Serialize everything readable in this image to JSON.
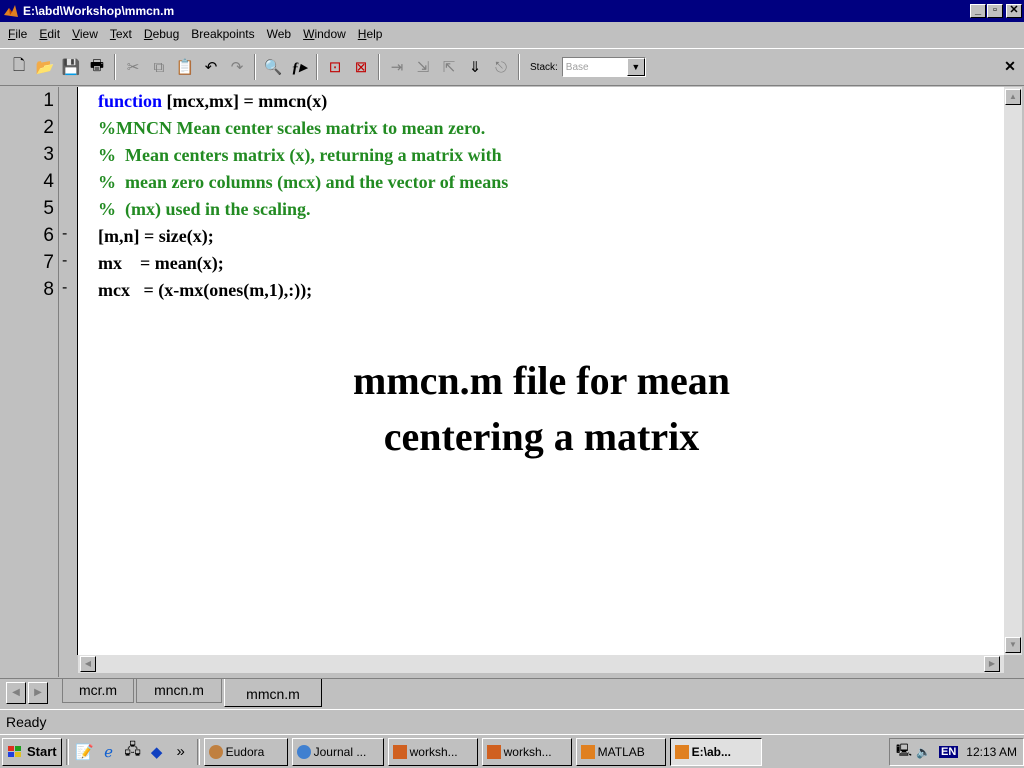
{
  "window": {
    "title": "E:\\abd\\Workshop\\mmcn.m",
    "min_label": "_",
    "max_label": "▫",
    "close_label": "✕"
  },
  "menu": [
    {
      "key": "F",
      "rest": "ile"
    },
    {
      "key": "E",
      "rest": "dit"
    },
    {
      "key": "V",
      "rest": "iew"
    },
    {
      "key": "T",
      "rest": "ext"
    },
    {
      "key": "D",
      "rest": "ebug"
    },
    {
      "key": "",
      "rest": "Breakpoints"
    },
    {
      "key": "",
      "rest": "Web"
    },
    {
      "key": "W",
      "rest": "indow"
    },
    {
      "key": "H",
      "rest": "elp"
    }
  ],
  "toolbar": {
    "stack_label": "Stack:",
    "stack_value": "Base",
    "icons": [
      "new-file-icon",
      "open-folder-icon",
      "save-icon",
      "print-icon",
      "cut-icon",
      "copy-icon",
      "paste-icon",
      "undo-icon",
      "redo-icon",
      "find-icon",
      "function-icon",
      "set-breakpoint-icon",
      "clear-breakpoints-icon",
      "step-icon",
      "step-in-icon",
      "step-out-icon",
      "continue-icon",
      "exit-debug-icon"
    ]
  },
  "editor": {
    "line_numbers": [
      "1",
      "2",
      "3",
      "4",
      "5",
      "6",
      "7",
      "8"
    ],
    "breakpoint_markers": [
      "",
      "",
      "",
      "",
      "",
      "-",
      "-",
      "-"
    ],
    "lines": [
      {
        "keyword": "function",
        "text": " [mcx,mx] = mmcn(x)",
        "kind": "code"
      },
      {
        "keyword": "",
        "text": "%MNCN Mean center scales matrix to mean zero.",
        "kind": "comment"
      },
      {
        "keyword": "",
        "text": "%  Mean centers matrix (x), returning a matrix with",
        "kind": "comment"
      },
      {
        "keyword": "",
        "text": "%  mean zero columns (mcx) and the vector of means",
        "kind": "comment"
      },
      {
        "keyword": "",
        "text": "%  (mx) used in the scaling.",
        "kind": "comment"
      },
      {
        "keyword": "",
        "text": "[m,n] = size(x);",
        "kind": "code"
      },
      {
        "keyword": "",
        "text": "mx    = mean(x);",
        "kind": "code"
      },
      {
        "keyword": "",
        "text": "mcx   = (x-mx(ones(m,1),:));",
        "kind": "code"
      }
    ],
    "caption_line1": "mmcn.m file for mean",
    "caption_line2": "centering a matrix"
  },
  "tabs": [
    {
      "label": "mcr.m",
      "active": false
    },
    {
      "label": "mncn.m",
      "active": false
    },
    {
      "label": "mmcn.m",
      "active": true
    }
  ],
  "status": {
    "text": "Ready"
  },
  "taskbar": {
    "start_label": "Start",
    "quicklaunch_more": "»",
    "tasks": [
      {
        "label": "Eudora",
        "active": false
      },
      {
        "label": "Journal ...",
        "active": false
      },
      {
        "label": "worksh...",
        "active": false
      },
      {
        "label": "worksh...",
        "active": false
      },
      {
        "label": "MATLAB",
        "active": false
      },
      {
        "label": "E:\\ab...",
        "active": true
      }
    ],
    "tray_lang": "EN",
    "clock": "12:13 AM"
  }
}
